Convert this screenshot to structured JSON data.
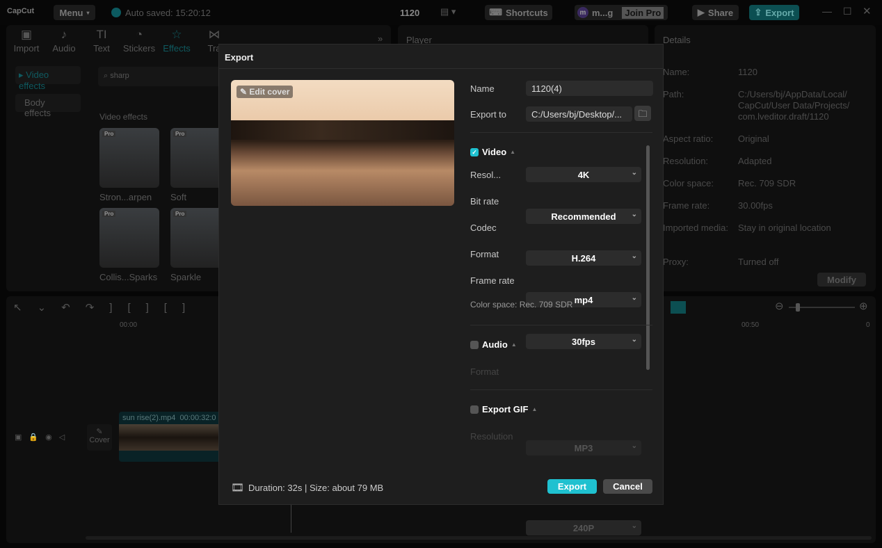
{
  "app": {
    "logo": "CapCut",
    "menu": "Menu",
    "autosave": "Auto saved: 15:20:12",
    "project": "1120",
    "shortcuts": "Shortcuts",
    "user": "m...g",
    "avatar": "m",
    "join_pro": "Join Pro",
    "share": "Share",
    "export": "Export"
  },
  "toolbar": [
    {
      "label": "Import",
      "icon": "import-icon"
    },
    {
      "label": "Audio",
      "icon": "audio-icon"
    },
    {
      "label": "Text",
      "icon": "text-icon"
    },
    {
      "label": "Stickers",
      "icon": "stickers-icon"
    },
    {
      "label": "Effects",
      "icon": "effects-icon"
    },
    {
      "label": "Tra",
      "icon": "transitions-icon"
    }
  ],
  "sidebar": {
    "items": [
      "Video effects",
      "Body effects"
    ]
  },
  "search": {
    "value": "sharp"
  },
  "effects": {
    "heading": "Video effects",
    "badge": "Pro",
    "items": [
      "Stron...arpen",
      "Soft",
      "Collis...Sparks",
      "Sparkle"
    ]
  },
  "player": {
    "title": "Player"
  },
  "details": {
    "title": "Details",
    "rows": [
      {
        "k": "Name:",
        "v": "1120"
      },
      {
        "k": "Path:",
        "v": "C:/Users/bj/AppData/Local/ CapCut/User Data/Projects/ com.lveditor.draft/1120"
      },
      {
        "k": "Aspect ratio:",
        "v": "Original"
      },
      {
        "k": "Resolution:",
        "v": "Adapted"
      },
      {
        "k": "Color space:",
        "v": "Rec. 709 SDR"
      },
      {
        "k": "Frame rate:",
        "v": "30.00fps"
      },
      {
        "k": "Imported media:",
        "v": "Stay in original location"
      },
      {
        "k": "Proxy:",
        "v": "Turned off"
      }
    ],
    "modify": "Modify"
  },
  "timeline": {
    "t0": "00:00",
    "t50": "00:50",
    "tend": "0",
    "clip_name": "sun rise(2).mp4",
    "clip_dur": "00:00:32:0",
    "cover": "Cover"
  },
  "dialog": {
    "title": "Export",
    "edit_cover": "Edit cover",
    "name_label": "Name",
    "name_value": "1120(4)",
    "export_to_label": "Export to",
    "export_to_value": "C:/Users/bj/Desktop/...",
    "video": {
      "title": "Video",
      "checked": true,
      "rows": [
        {
          "label": "Resol...",
          "value": "4K"
        },
        {
          "label": "Bit rate",
          "value": "Recommended"
        },
        {
          "label": "Codec",
          "value": "H.264"
        },
        {
          "label": "Format",
          "value": "mp4"
        },
        {
          "label": "Frame rate",
          "value": "30fps"
        }
      ],
      "color_space": "Color space: Rec. 709 SDR"
    },
    "audio": {
      "title": "Audio",
      "checked": false,
      "format_label": "Format",
      "format_value": "MP3"
    },
    "gif": {
      "title": "Export GIF",
      "checked": false,
      "res_label": "Resolution",
      "res_value": "240P"
    },
    "footer": "Duration: 32s | Size: about 79 MB",
    "export_btn": "Export",
    "cancel_btn": "Cancel"
  },
  "colors": {
    "accent": "#00b8c8",
    "dialog_bg": "#1e1e1e"
  }
}
